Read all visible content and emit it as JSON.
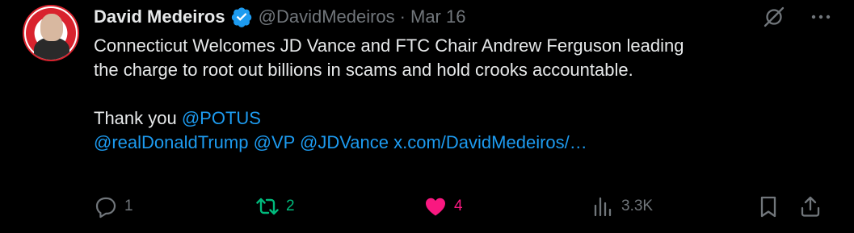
{
  "author": {
    "name": "David Medeiros",
    "handle": "@DavidMedeiros",
    "separator": "·",
    "date": "Mar 16",
    "avatar_label": "AVATAR"
  },
  "tweet": {
    "line1": "Connecticut Welcomes  JD Vance and FTC Chair Andrew Ferguson leading",
    "line2": "the charge to root out billions in scams and hold crooks accountable.",
    "thanks": "Thank you ",
    "mention_potus": "@POTUS",
    "mention_trump": "@realDonaldTrump",
    "mention_vp": "@VP",
    "mention_jdvance": "@JDVance",
    "link": "x.com/DavidMedeiros/…"
  },
  "actions": {
    "replies": "1",
    "reposts": "2",
    "likes": "4",
    "views": "3.3K"
  },
  "colors": {
    "background": "#000000",
    "text": "#e7e9ea",
    "muted": "#71767b",
    "link": "#1d9bf0",
    "repost": "#00ba7c",
    "like": "#f91880"
  },
  "icons": [
    "verified-badge-icon",
    "grok-icon",
    "more-icon",
    "reply-icon",
    "repost-icon",
    "like-icon",
    "views-icon",
    "bookmark-icon",
    "share-icon"
  ]
}
